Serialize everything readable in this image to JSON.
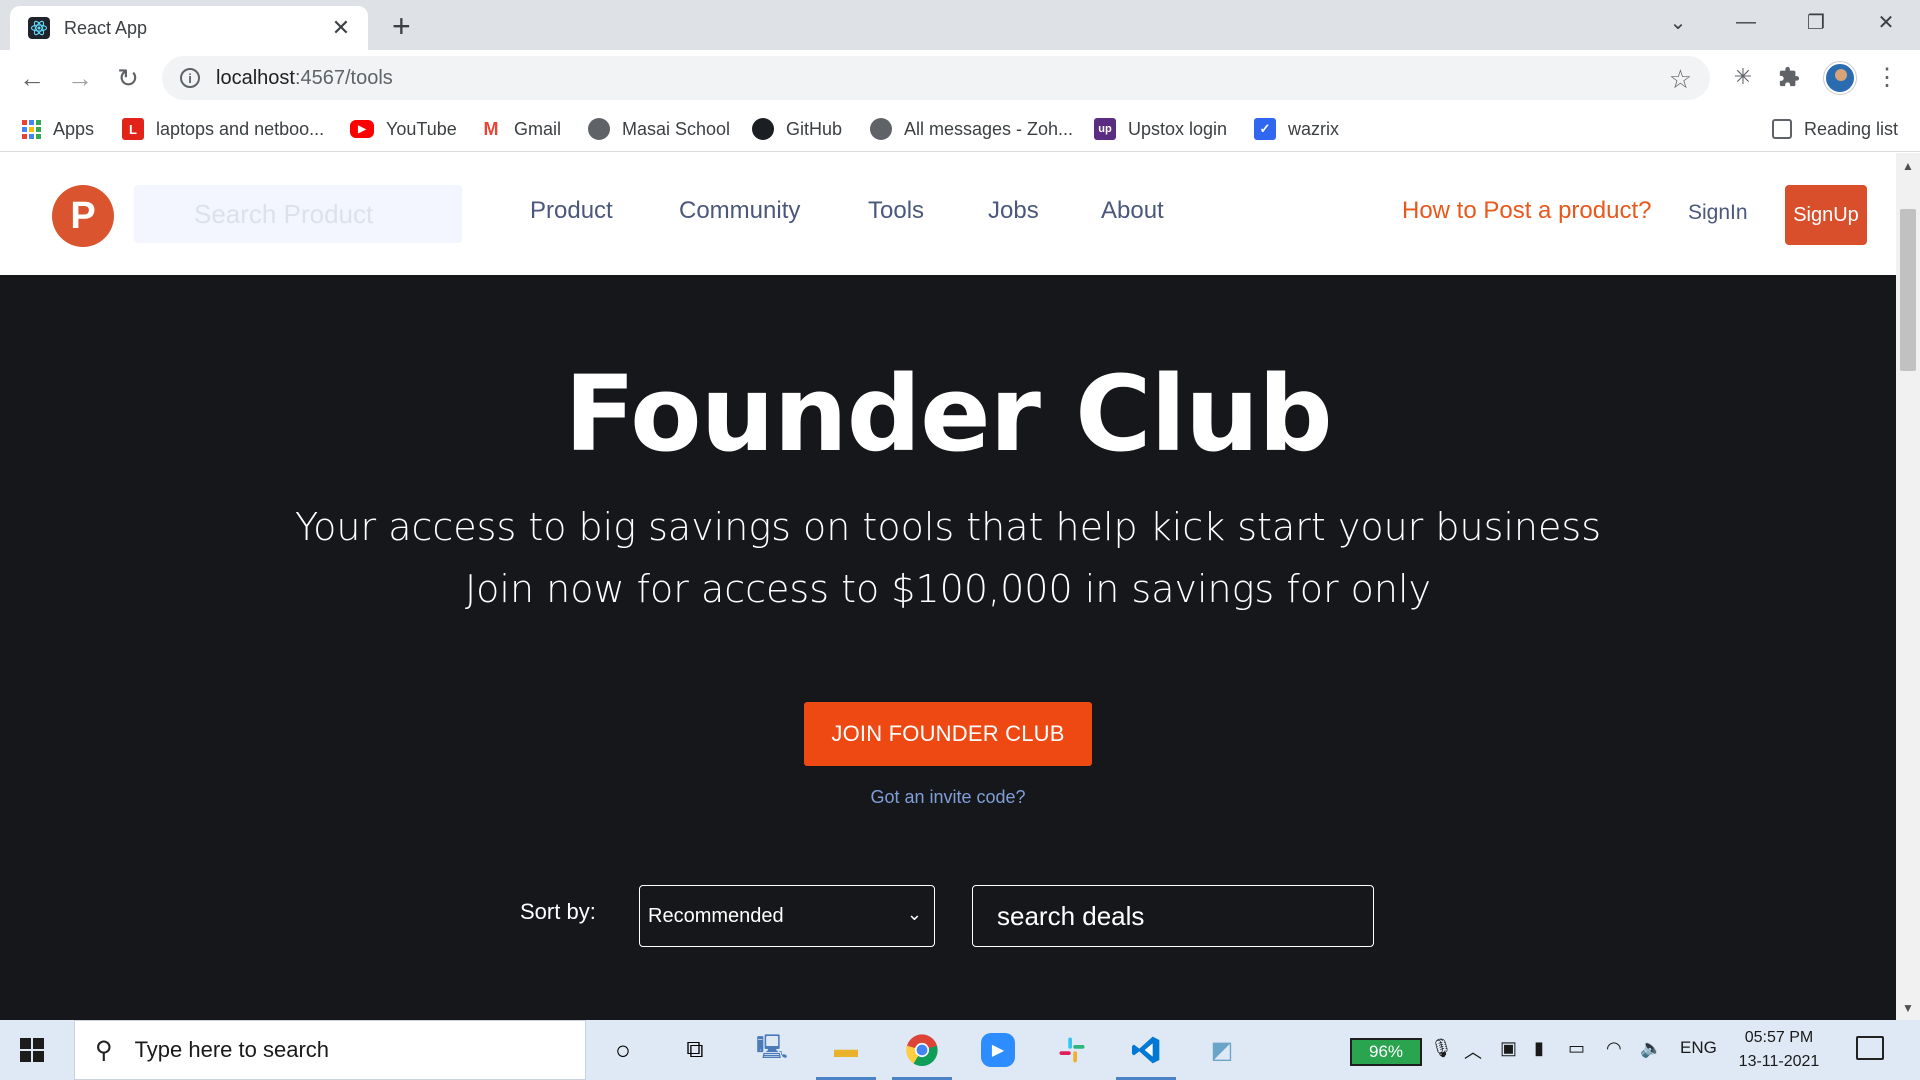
{
  "browser": {
    "tab_title": "React App",
    "url_host": "localhost",
    "url_path": ":4567/tools",
    "bookmarks": [
      {
        "label": "Apps",
        "icon": "apps-grid-icon"
      },
      {
        "label": "laptops and netboo...",
        "icon": "lenovo-icon",
        "color": "#e2231a"
      },
      {
        "label": "YouTube",
        "icon": "youtube-icon",
        "color": "#ff0000"
      },
      {
        "label": "Gmail",
        "icon": "gmail-icon",
        "color": "#ea4335"
      },
      {
        "label": "Masai School",
        "icon": "globe-icon"
      },
      {
        "label": "GitHub",
        "icon": "github-icon"
      },
      {
        "label": "All messages - Zoh...",
        "icon": "globe-icon"
      },
      {
        "label": "Upstox login",
        "icon": "upstox-icon",
        "color": "#5a2d82"
      },
      {
        "label": "wazrix",
        "icon": "wazirx-icon",
        "color": "#3067f0"
      }
    ],
    "reading_list": "Reading list"
  },
  "header": {
    "search_placeholder": "Search Product",
    "nav": [
      "Product",
      "Community",
      "Tools",
      "Jobs",
      "About"
    ],
    "post_link": "How to Post a product?",
    "signin": "SignIn",
    "signup": "SignUp",
    "logo_letter": "P",
    "brand_color": "#da552f"
  },
  "hero": {
    "title": "Founder Club",
    "line1": "Your access to big savings on tools that help kick start your business",
    "line2": "Join now for access to $100,000 in savings for only",
    "cta": "JOIN FOUNDER CLUB",
    "invite": "Got an invite code?",
    "cta_color": "#ee4813"
  },
  "filters": {
    "sort_label": "Sort by:",
    "sort_value": "Recommended",
    "search_placeholder": "search deals"
  },
  "taskbar": {
    "search_placeholder": "Type here to search",
    "battery": "96%",
    "language": "ENG",
    "time": "05:57 PM",
    "date": "13-11-2021"
  }
}
